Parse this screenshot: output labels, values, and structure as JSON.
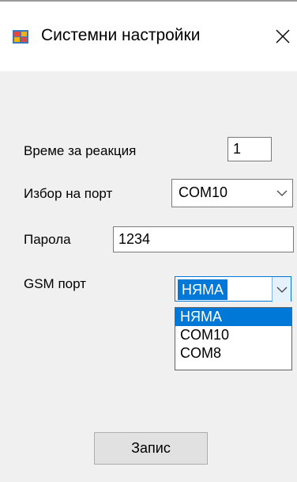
{
  "window": {
    "title": "Системни настройки",
    "icon": "app-window-icon",
    "close_glyph": "✕"
  },
  "form": {
    "reaction_time": {
      "label": "Време за реакция",
      "value": "1"
    },
    "port_select": {
      "label": "Избор на порт",
      "selected": "COM10"
    },
    "password": {
      "label": "Парола",
      "value": "1234"
    },
    "gsm_port": {
      "label": "GSM порт",
      "selected": "НЯМА",
      "options": [
        "НЯМА",
        "COM10",
        "COM8"
      ]
    }
  },
  "buttons": {
    "save_label": "Запис"
  },
  "colors": {
    "selection_blue": "#0078d7",
    "window_bg": "#f0f0f0",
    "button_bg": "#e1e1e1"
  }
}
